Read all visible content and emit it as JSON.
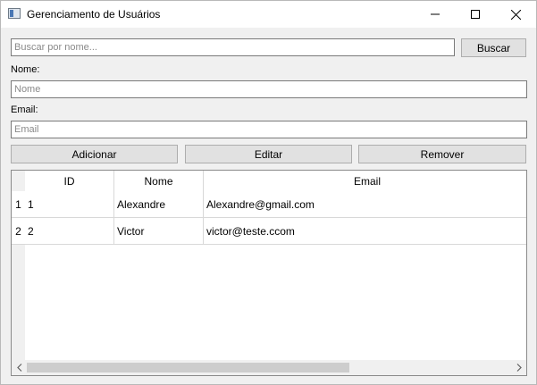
{
  "window": {
    "title": "Gerenciamento de Usuários"
  },
  "search": {
    "placeholder": "Buscar por nome...",
    "value": "",
    "button_label": "Buscar"
  },
  "form": {
    "name_label": "Nome:",
    "name_placeholder": "Nome",
    "email_label": "Email:",
    "email_placeholder": "Email"
  },
  "actions": {
    "add_label": "Adicionar",
    "edit_label": "Editar",
    "remove_label": "Remover"
  },
  "table": {
    "columns": [
      "ID",
      "Nome",
      "Email"
    ],
    "rows": [
      {
        "row_number": "1",
        "id": "1",
        "nome": "Alexandre",
        "email": "Alexandre@gmail.com"
      },
      {
        "row_number": "2",
        "id": "2",
        "nome": "Victor",
        "email": "victor@teste.ccom"
      }
    ]
  },
  "icons": {
    "app": "app-window-icon",
    "minimize": "minimize-icon",
    "maximize": "maximize-icon",
    "close": "close-icon",
    "scroll_left": "chevron-left-icon",
    "scroll_right": "chevron-right-icon"
  },
  "colors": {
    "window_bg": "#f0f0f0",
    "button_bg": "#e1e1e1",
    "button_border": "#adadad",
    "scroll_thumb": "#cdcdcd"
  }
}
